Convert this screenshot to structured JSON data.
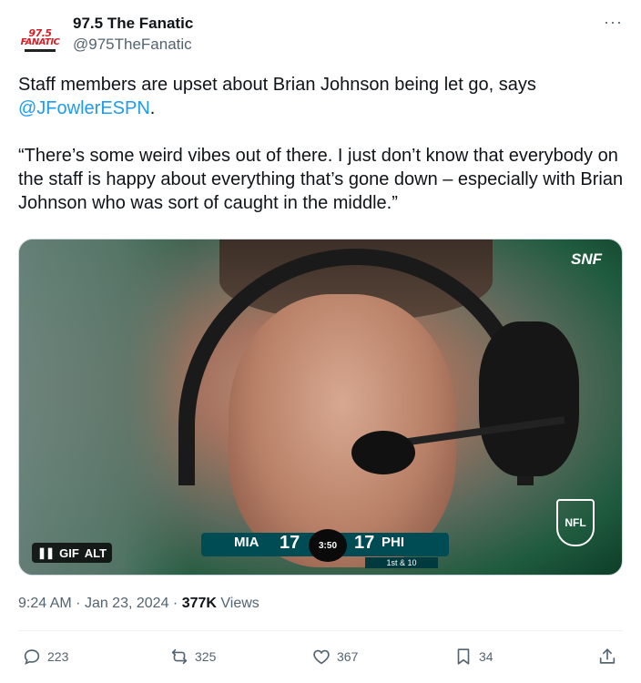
{
  "author": {
    "avatar": {
      "logo_line1": "97.5",
      "logo_line2": "FANATIC"
    },
    "name": "97.5 The Fanatic",
    "handle": "@975TheFanatic",
    "more_label": "···"
  },
  "body": {
    "line1_prefix": "Staff members are upset about Brian Johnson being let go, says",
    "mention": "@JFowlerESPN",
    "line1_suffix": ".",
    "quote": "“There’s some weird vibes out of there. I just don’t know that everybody on the staff is happy about everything that’s gone down – especially with Brian Johnson who was sort of caught in the middle.”"
  },
  "media": {
    "network_logo": "SNF",
    "league_logo": "NFL",
    "badge_gif": "GIF",
    "badge_alt": "ALT",
    "scorebug": {
      "away_team": "MIA",
      "away_score": "17",
      "clock": "3:50",
      "home_team": "PHI",
      "home_score": "17",
      "down_distance": "1st & 10"
    }
  },
  "meta": {
    "time": "9:24 AM",
    "separator": "·",
    "date": "Jan 23, 2024",
    "views_count": "377K",
    "views_label": "Views"
  },
  "actions": {
    "replies": "223",
    "reposts": "325",
    "likes": "367",
    "bookmarks": "34"
  },
  "colors": {
    "accent": "#1d9bf0",
    "text": "#0f1419",
    "secondary": "#536471",
    "eagles_green": "#004c54"
  }
}
